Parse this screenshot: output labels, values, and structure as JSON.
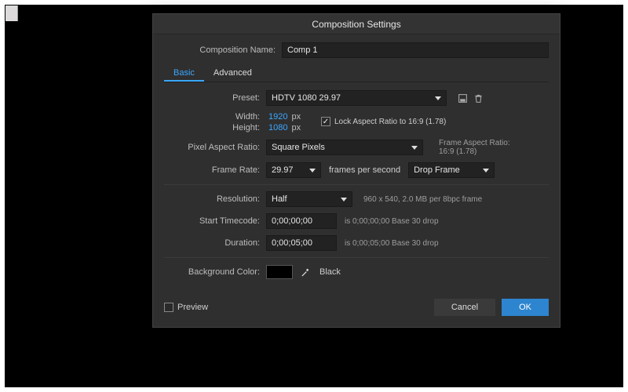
{
  "dialog": {
    "title": "Composition Settings",
    "compNameLabel": "Composition Name:",
    "compName": "Comp 1",
    "tabs": [
      "Basic",
      "Advanced"
    ],
    "presetLabel": "Preset:",
    "preset": "HDTV 1080 29.97",
    "widthLabel": "Width:",
    "width": "1920",
    "heightLabel": "Height:",
    "height": "1080",
    "pxUnit": "px",
    "lockAspect": "Lock Aspect Ratio to 16:9 (1.78)",
    "parLabel": "Pixel Aspect Ratio:",
    "par": "Square Pixels",
    "farLabel": "Frame Aspect Ratio:",
    "farValue": "16:9 (1.78)",
    "frLabel": "Frame Rate:",
    "fr": "29.97",
    "fps": "frames per second",
    "dropFrame": "Drop Frame",
    "resLabel": "Resolution:",
    "res": "Half",
    "resInfo": "960 x 540, 2.0 MB per 8bpc frame",
    "startTCLabel": "Start Timecode:",
    "startTC": "0;00;00;00",
    "startTCInfo": "is 0;00;00;00 Base 30  drop",
    "durLabel": "Duration:",
    "dur": "0;00;05;00",
    "durInfo": "is 0;00;05;00  Base 30  drop",
    "bgLabel": "Background Color:",
    "bgName": "Black",
    "previewLabel": "Preview",
    "cancel": "Cancel",
    "ok": "OK"
  }
}
